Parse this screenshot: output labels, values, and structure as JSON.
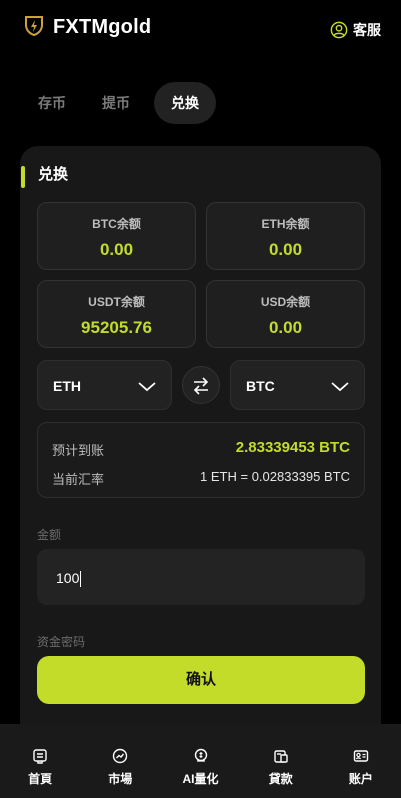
{
  "header": {
    "brand": "FXTMgold",
    "support_label": "客服",
    "logo_icon": "shield-lightning-icon",
    "support_icon": "user-circle-icon"
  },
  "tabs": [
    {
      "label": "存币",
      "active": false
    },
    {
      "label": "提币",
      "active": false
    },
    {
      "label": "兑换",
      "active": true
    }
  ],
  "exchange": {
    "title": "兑换",
    "balances": [
      {
        "label": "BTC余额",
        "value": "0.00"
      },
      {
        "label": "ETH余额",
        "value": "0.00"
      },
      {
        "label": "USDT余额",
        "value": "95205.76"
      },
      {
        "label": "USD余额",
        "value": "0.00"
      }
    ],
    "from_currency": "ETH",
    "to_currency": "BTC",
    "estimated_label": "预计到账",
    "estimated_value": "2.83339453 BTC",
    "rate_label": "当前汇率",
    "rate_value": "1 ETH = 0.02833395 BTC",
    "amount_label": "金额",
    "amount_value": "100",
    "password_label": "资金密码",
    "confirm_label": "确认"
  },
  "nav": [
    {
      "label": "首頁",
      "icon": "home-icon"
    },
    {
      "label": "市場",
      "icon": "market-icon"
    },
    {
      "label": "AI量化",
      "icon": "ai-quant-icon"
    },
    {
      "label": "貸款",
      "icon": "loan-icon"
    },
    {
      "label": "账户",
      "icon": "account-icon"
    }
  ],
  "colors": {
    "accent": "#c3dc2a",
    "background": "#000000",
    "card": "#181818"
  }
}
